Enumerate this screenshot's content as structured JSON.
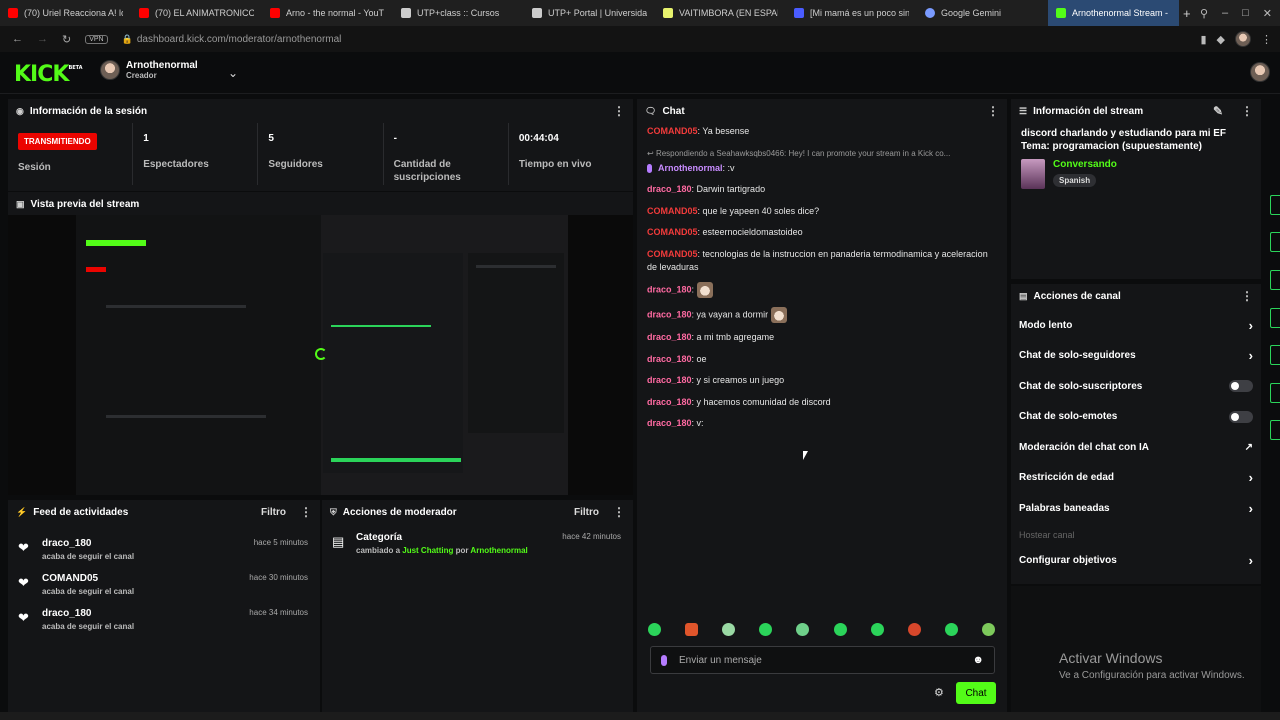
{
  "browser": {
    "tabs": [
      {
        "label": "(70) Uriel Reacciona A! lo",
        "color": "#ff0000"
      },
      {
        "label": "(70) EL ANIMATRONICO",
        "color": "#ff0000"
      },
      {
        "label": "Arno - the normal - YouT",
        "color": "#ff0000"
      },
      {
        "label": "UTP+class :: Cursos",
        "color": "#cccccc"
      },
      {
        "label": "UTP+ Portal | Universida",
        "color": "#cccccc"
      },
      {
        "label": "VAITIMBORA (EN ESPAÑ",
        "color": "#e7f26d"
      },
      {
        "label": "[Mi mamá es un poco sin",
        "color": "#4a5cff"
      },
      {
        "label": "Google Gemini",
        "color": "#7a9bff"
      },
      {
        "label": "Arnothenormal Stream - K",
        "color": "#53fc18"
      }
    ],
    "new_tab": "+",
    "url": "dashboard.kick.com/moderator/arnothenormal",
    "vpn": "VPN"
  },
  "header": {
    "logo": "KICK",
    "logo_badge": "BETA",
    "account_name": "Arnothenormal",
    "account_role": "Creador"
  },
  "session": {
    "title": "Información de la sesión",
    "live_badge": "TRANSMITIENDO",
    "live_label": "Sesión",
    "stats": [
      {
        "value": "1",
        "label": "Espectadores"
      },
      {
        "value": "5",
        "label": "Seguidores"
      },
      {
        "value": "-",
        "label": "Cantidad de suscripciones"
      },
      {
        "value": "00:44:04",
        "label": "Tiempo en vivo"
      }
    ]
  },
  "preview": {
    "title": "Vista previa del stream"
  },
  "feed": {
    "title": "Feed de actividades",
    "filter": "Filtro",
    "items": [
      {
        "name": "draco_180",
        "action": "acaba de seguir el canal",
        "time": "hace 5 minutos"
      },
      {
        "name": "COMAND05",
        "action": "acaba de seguir el canal",
        "time": "hace 30 minutos"
      },
      {
        "name": "draco_180",
        "action": "acaba de seguir el canal",
        "time": "hace 34 minutos"
      }
    ]
  },
  "modactions": {
    "title": "Acciones de moderador",
    "filter": "Filtro",
    "item": {
      "title": "Categoría",
      "prefix": "cambiado a",
      "category": "Just Chatting",
      "by": "por",
      "user": "Arnothenormal",
      "time": "hace 42 minutos"
    }
  },
  "chat": {
    "title": "Chat",
    "messages": [
      {
        "user": "COMAND05",
        "text": "Ya besense"
      },
      {
        "reply": "Respondiendo a Seahawksqbs0466: Hey! I can promote your stream in a Kick co...",
        "user": "Arnothenormal",
        "text": ":v"
      },
      {
        "user": "draco_180",
        "text": "Darwin tartigrado"
      },
      {
        "user": "COMAND05",
        "text": "que le yapeen 40 soles dice?"
      },
      {
        "user": "COMAND05",
        "text": "esteernocieldomastoideo"
      },
      {
        "user": "COMAND05",
        "text": "tecnologias de la instruccion en panaderia termodinamica y aceleracion de levaduras"
      },
      {
        "user": "draco_180",
        "text": ""
      },
      {
        "user": "draco_180",
        "text": "ya vayan a dormir"
      },
      {
        "user": "draco_180",
        "text": "a mi tmb agregame"
      },
      {
        "user": "draco_180",
        "text": "oe"
      },
      {
        "user": "draco_180",
        "text": "y si creamos un juego"
      },
      {
        "user": "draco_180",
        "text": "y hacemos comunidad de discord"
      },
      {
        "user": "draco_180",
        "text": "v:"
      }
    ],
    "input_placeholder": "Enviar un mensaje",
    "send": "Chat"
  },
  "streaminfo": {
    "title": "Información del stream",
    "stream_title": "discord charlando y estudiando para mi EF Tema: programacion (supuestamente)",
    "category": "Conversando",
    "language": "Spanish"
  },
  "channel_actions": {
    "title": "Acciones de canal",
    "items": [
      {
        "label": "Modo lento",
        "control": "arrow"
      },
      {
        "label": "Chat de solo-seguidores",
        "control": "arrow"
      },
      {
        "label": "Chat de solo-suscriptores",
        "control": "toggle"
      },
      {
        "label": "Chat de solo-emotes",
        "control": "toggle"
      },
      {
        "label": "Moderación del chat con IA",
        "control": "external"
      },
      {
        "label": "Restricción de edad",
        "control": "arrow"
      },
      {
        "label": "Palabras baneadas",
        "control": "arrow"
      },
      {
        "label": "Hostear canal",
        "control": "disabled"
      },
      {
        "label": "Configurar objetivos",
        "control": "arrow"
      }
    ]
  },
  "windows": {
    "activate_title": "Activar Windows",
    "activate_sub": "Ve a Configuración para activar Windows."
  }
}
